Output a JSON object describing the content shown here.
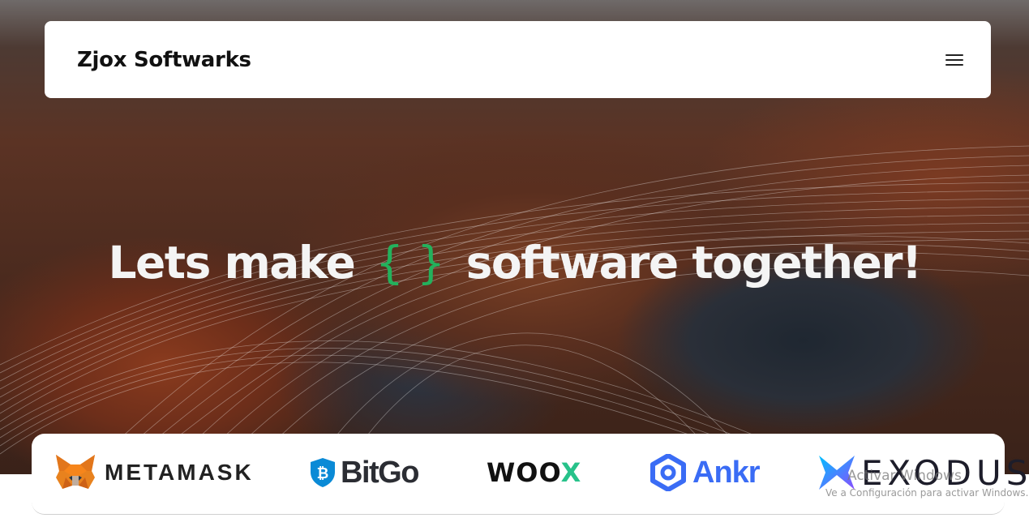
{
  "navbar": {
    "brand": "Zjox Softwarks",
    "menu_icon": "hamburger-menu-icon"
  },
  "hero": {
    "headline_before": "Lets make",
    "headline_brace_open": "{",
    "headline_brace_close": "}",
    "headline_after": "software together!",
    "brace_color": "#23b15c"
  },
  "logos": {
    "items": [
      {
        "name": "METAMASK",
        "icon": "metamask-fox-icon"
      },
      {
        "name": "BitGo",
        "icon": "bitgo-shield-icon"
      },
      {
        "name": "WOOX",
        "icon": "woox-wordmark"
      },
      {
        "name": "Ankr",
        "icon": "ankr-icon"
      },
      {
        "name": "EXODUS",
        "icon": "exodus-x-icon"
      }
    ]
  },
  "watermark": {
    "title": "Activar Windows",
    "subtitle": "Ve a Configuración para activar Windows."
  }
}
